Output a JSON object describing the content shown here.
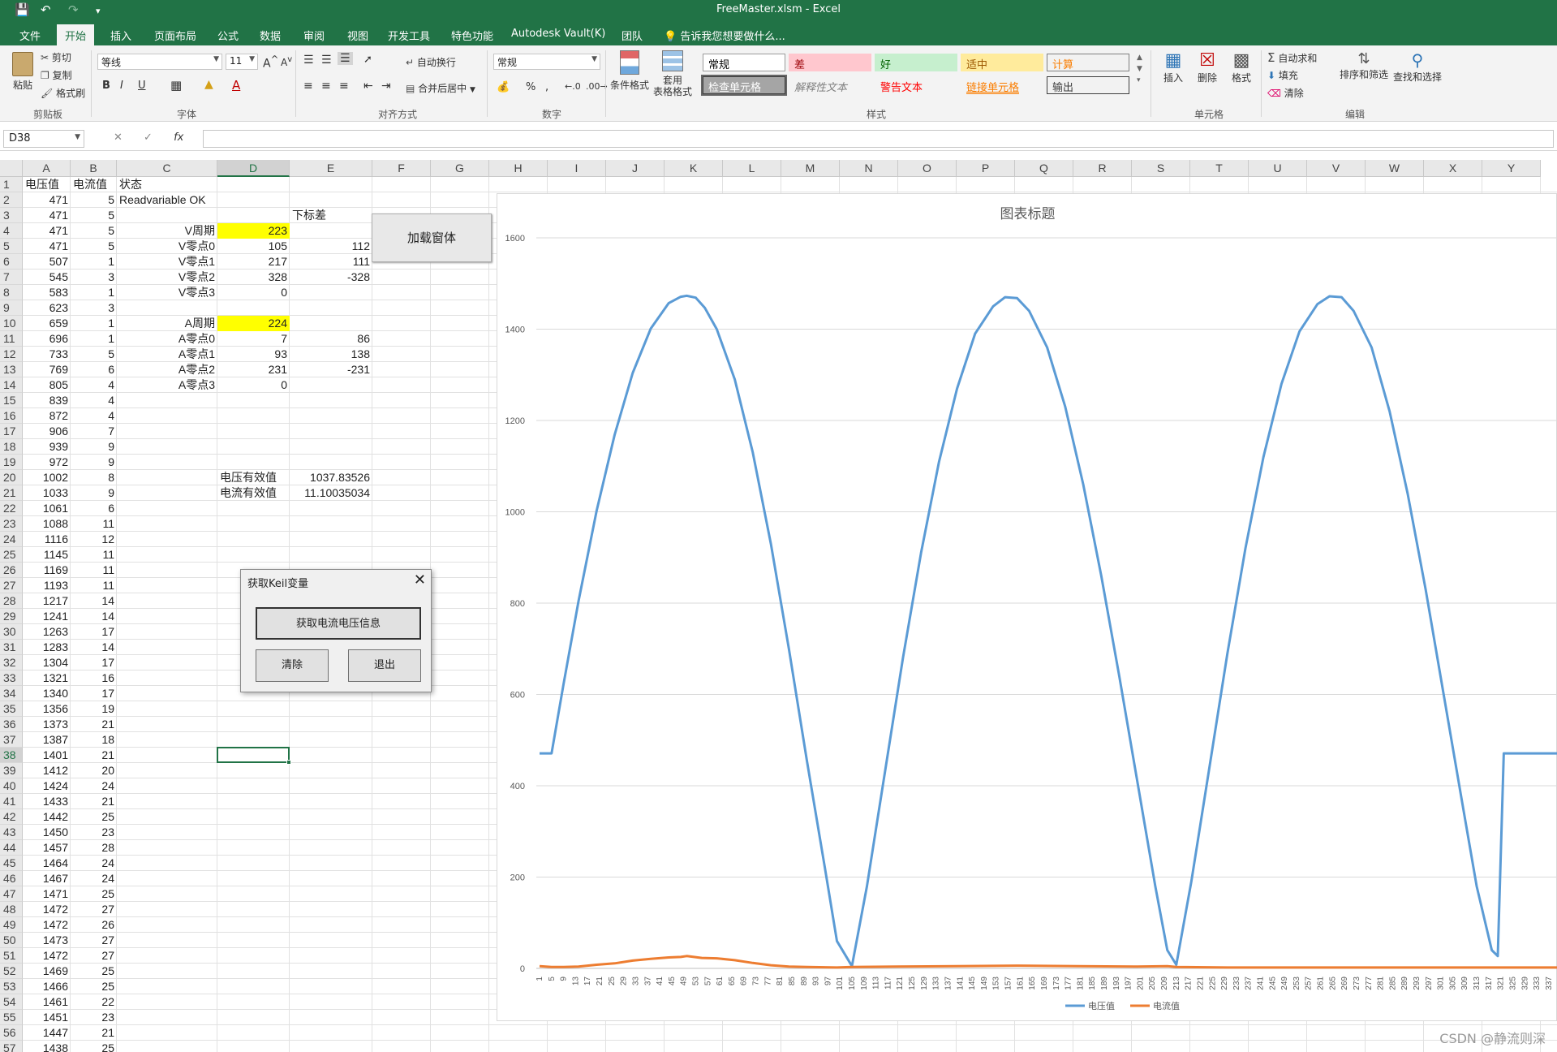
{
  "window": {
    "title": "FreeMaster.xlsm - Excel"
  },
  "tabs": [
    "文件",
    "开始",
    "插入",
    "页面布局",
    "公式",
    "数据",
    "审阅",
    "视图",
    "开发工具",
    "特色功能",
    "Autodesk Vault(K)",
    "团队",
    "告诉我您想要做什么..."
  ],
  "ribbon": {
    "clipboard": {
      "paste": "粘贴",
      "cut": "剪切",
      "copy": "复制",
      "format_painter": "格式刷",
      "label": "剪贴板"
    },
    "font": {
      "name": "等线",
      "size": "11",
      "bold": "B",
      "italic": "I",
      "underline": "U",
      "label": "字体"
    },
    "alignment": {
      "wrap": "自动换行",
      "merge": "合并后居中",
      "label": "对齐方式"
    },
    "number": {
      "format": "常规",
      "percent": "%",
      "comma": ",",
      "label": "数字"
    },
    "styles": {
      "cond_format": "条件格式",
      "table_format_1": "套用",
      "table_format_2": "表格格式",
      "cells": [
        {
          "text": "常规",
          "bg": "#ffffff",
          "fg": "#000000",
          "border": "#9a9a9a"
        },
        {
          "text": "差",
          "bg": "#ffc7ce",
          "fg": "#9c0006",
          "border": "#ffc7ce"
        },
        {
          "text": "好",
          "bg": "#c6efce",
          "fg": "#006100",
          "border": "#c6efce"
        },
        {
          "text": "适中",
          "bg": "#ffeb9c",
          "fg": "#9c5700",
          "border": "#ffeb9c"
        },
        {
          "text": "计算",
          "bg": "#f2f2f2",
          "fg": "#fa7d00",
          "border": "#7f7f7f"
        },
        {
          "text": "检查单元格",
          "bg": "#a5a5a5",
          "fg": "#ffffff",
          "border": "#3f3f3f"
        },
        {
          "text": "解释性文本",
          "bg": "#f3f3f3",
          "fg": "#7f7f7f",
          "border": "#f3f3f3"
        },
        {
          "text": "警告文本",
          "bg": "#f3f3f3",
          "fg": "#ff0000",
          "border": "#f3f3f3"
        },
        {
          "text": "链接单元格",
          "bg": "#f3f3f3",
          "fg": "#fa7d00",
          "border": "#f3f3f3"
        },
        {
          "text": "输出",
          "bg": "#f2f2f2",
          "fg": "#3f3f3f",
          "border": "#3f3f3f"
        }
      ],
      "label": "样式"
    },
    "cells_group": {
      "insert": "插入",
      "delete": "删除",
      "format": "格式",
      "label": "单元格"
    },
    "editing": {
      "autosum": "自动求和",
      "fill": "填充",
      "clear": "清除",
      "sort_filter": "排序和筛选",
      "find_select": "查找和选择",
      "label": "编辑"
    }
  },
  "formula_bar": {
    "name_box": "D38",
    "fx": "fx",
    "value": ""
  },
  "columns": [
    "A",
    "B",
    "C",
    "D",
    "E",
    "F",
    "G",
    "H",
    "I",
    "J",
    "K",
    "L",
    "M",
    "N",
    "O",
    "P",
    "Q",
    "R",
    "S",
    "T",
    "U",
    "V",
    "W",
    "X",
    "Y"
  ],
  "selected_cell": {
    "col": "D",
    "row": 38
  },
  "sheet": {
    "A": [
      "电压值",
      471,
      471,
      471,
      471,
      507,
      545,
      583,
      623,
      659,
      696,
      733,
      769,
      805,
      839,
      872,
      906,
      939,
      972,
      1002,
      1033,
      1061,
      1088,
      1116,
      1145,
      1169,
      1193,
      1217,
      1241,
      1263,
      1283,
      1304,
      1321,
      1340,
      1356,
      1373,
      1387,
      1401,
      1412,
      1424,
      1433,
      1442,
      1450,
      1457,
      1464,
      1467,
      1471,
      1472,
      1472,
      1473,
      1472,
      1469,
      1466,
      1461,
      1451,
      1447,
      1438
    ],
    "B": [
      "电流值",
      5,
      5,
      5,
      5,
      1,
      3,
      1,
      3,
      1,
      1,
      5,
      6,
      4,
      4,
      4,
      7,
      9,
      9,
      8,
      9,
      6,
      11,
      12,
      11,
      11,
      11,
      14,
      14,
      17,
      14,
      17,
      16,
      17,
      19,
      21,
      18,
      21,
      20,
      24,
      21,
      25,
      23,
      28,
      24,
      24,
      25,
      27,
      26,
      27,
      27,
      25,
      25,
      22,
      23,
      21,
      25
    ],
    "C1": "状态",
    "C2": "Readvariable OK",
    "E3": "下标差",
    "labels_c": [
      {
        "row": 4,
        "text": "V周期"
      },
      {
        "row": 5,
        "text": "V零点0"
      },
      {
        "row": 6,
        "text": "V零点1"
      },
      {
        "row": 7,
        "text": "V零点2"
      },
      {
        "row": 8,
        "text": "V零点3"
      },
      {
        "row": 10,
        "text": "A周期"
      },
      {
        "row": 11,
        "text": "A零点0"
      },
      {
        "row": 12,
        "text": "A零点1"
      },
      {
        "row": 13,
        "text": "A零点2"
      },
      {
        "row": 14,
        "text": "A零点3"
      }
    ],
    "values_d": [
      {
        "row": 4,
        "text": "223",
        "highlight": true
      },
      {
        "row": 5,
        "text": "105"
      },
      {
        "row": 6,
        "text": "217"
      },
      {
        "row": 7,
        "text": "328"
      },
      {
        "row": 8,
        "text": "0"
      },
      {
        "row": 10,
        "text": "224",
        "highlight": true
      },
      {
        "row": 11,
        "text": "7"
      },
      {
        "row": 12,
        "text": "93"
      },
      {
        "row": 13,
        "text": "231"
      },
      {
        "row": 14,
        "text": "0"
      }
    ],
    "values_e": [
      {
        "row": 5,
        "text": "112"
      },
      {
        "row": 6,
        "text": "111"
      },
      {
        "row": 7,
        "text": "-328"
      },
      {
        "row": 11,
        "text": "86"
      },
      {
        "row": 12,
        "text": "138"
      },
      {
        "row": 13,
        "text": "-231"
      }
    ],
    "rms": [
      {
        "row": 20,
        "label": "电压有效值",
        "value": "1037.83526"
      },
      {
        "row": 21,
        "label": "电流有效值",
        "value": "11.10035034"
      }
    ]
  },
  "sheet_button": {
    "label": "加载窗体"
  },
  "dialog": {
    "title": "获取Keil变量",
    "get_info": "获取电流电压信息",
    "clear": "清除",
    "exit": "退出"
  },
  "chart_data": {
    "type": "line",
    "title": "图表标题",
    "ylim": [
      0,
      1600
    ],
    "yticks": [
      0,
      200,
      400,
      600,
      800,
      1000,
      1200,
      1400,
      1600
    ],
    "x_start": 1,
    "x_end": 340,
    "x_tick_step": 4,
    "series": [
      {
        "name": "电压值",
        "color": "#5b9bd5",
        "points": [
          [
            1,
            471
          ],
          [
            3,
            471
          ],
          [
            4,
            471
          ],
          [
            5,
            471
          ],
          [
            9,
            623
          ],
          [
            14,
            805
          ],
          [
            20,
            1002
          ],
          [
            26,
            1169
          ],
          [
            32,
            1304
          ],
          [
            38,
            1401
          ],
          [
            44,
            1457
          ],
          [
            48,
            1471
          ],
          [
            50,
            1473
          ],
          [
            53,
            1469
          ],
          [
            56,
            1447
          ],
          [
            60,
            1400
          ],
          [
            66,
            1290
          ],
          [
            72,
            1130
          ],
          [
            78,
            930
          ],
          [
            84,
            700
          ],
          [
            90,
            455
          ],
          [
            96,
            220
          ],
          [
            100,
            60
          ],
          [
            105,
            5
          ],
          [
            110,
            180
          ],
          [
            116,
            430
          ],
          [
            122,
            680
          ],
          [
            128,
            910
          ],
          [
            134,
            1110
          ],
          [
            140,
            1270
          ],
          [
            146,
            1390
          ],
          [
            152,
            1450
          ],
          [
            156,
            1470
          ],
          [
            160,
            1468
          ],
          [
            164,
            1440
          ],
          [
            170,
            1360
          ],
          [
            176,
            1230
          ],
          [
            182,
            1060
          ],
          [
            188,
            860
          ],
          [
            194,
            640
          ],
          [
            200,
            410
          ],
          [
            206,
            180
          ],
          [
            210,
            40
          ],
          [
            213,
            8
          ],
          [
            218,
            190
          ],
          [
            224,
            440
          ],
          [
            230,
            690
          ],
          [
            236,
            920
          ],
          [
            242,
            1120
          ],
          [
            248,
            1280
          ],
          [
            254,
            1395
          ],
          [
            260,
            1455
          ],
          [
            264,
            1472
          ],
          [
            268,
            1470
          ],
          [
            272,
            1440
          ],
          [
            278,
            1360
          ],
          [
            284,
            1220
          ],
          [
            290,
            1040
          ],
          [
            296,
            830
          ],
          [
            302,
            600
          ],
          [
            308,
            370
          ],
          [
            313,
            180
          ],
          [
            318,
            40
          ],
          [
            320,
            27
          ],
          [
            322,
            471
          ],
          [
            326,
            471
          ],
          [
            340,
            471
          ]
        ]
      },
      {
        "name": "电流值",
        "color": "#ed7d31",
        "points": [
          [
            1,
            5
          ],
          [
            5,
            3
          ],
          [
            9,
            3
          ],
          [
            14,
            4
          ],
          [
            20,
            8
          ],
          [
            26,
            11
          ],
          [
            32,
            17
          ],
          [
            38,
            21
          ],
          [
            44,
            24
          ],
          [
            48,
            25
          ],
          [
            50,
            27
          ],
          [
            55,
            23
          ],
          [
            60,
            22
          ],
          [
            66,
            18
          ],
          [
            72,
            12
          ],
          [
            78,
            7
          ],
          [
            84,
            4
          ],
          [
            90,
            3
          ],
          [
            100,
            2
          ],
          [
            105,
            3
          ],
          [
            120,
            4
          ],
          [
            140,
            5
          ],
          [
            160,
            6
          ],
          [
            180,
            5
          ],
          [
            200,
            4
          ],
          [
            210,
            5
          ],
          [
            213,
            3
          ],
          [
            230,
            2
          ],
          [
            260,
            2
          ],
          [
            290,
            2
          ],
          [
            320,
            2
          ],
          [
            340,
            2
          ]
        ]
      }
    ]
  },
  "watermark": "CSDN @静流则深"
}
